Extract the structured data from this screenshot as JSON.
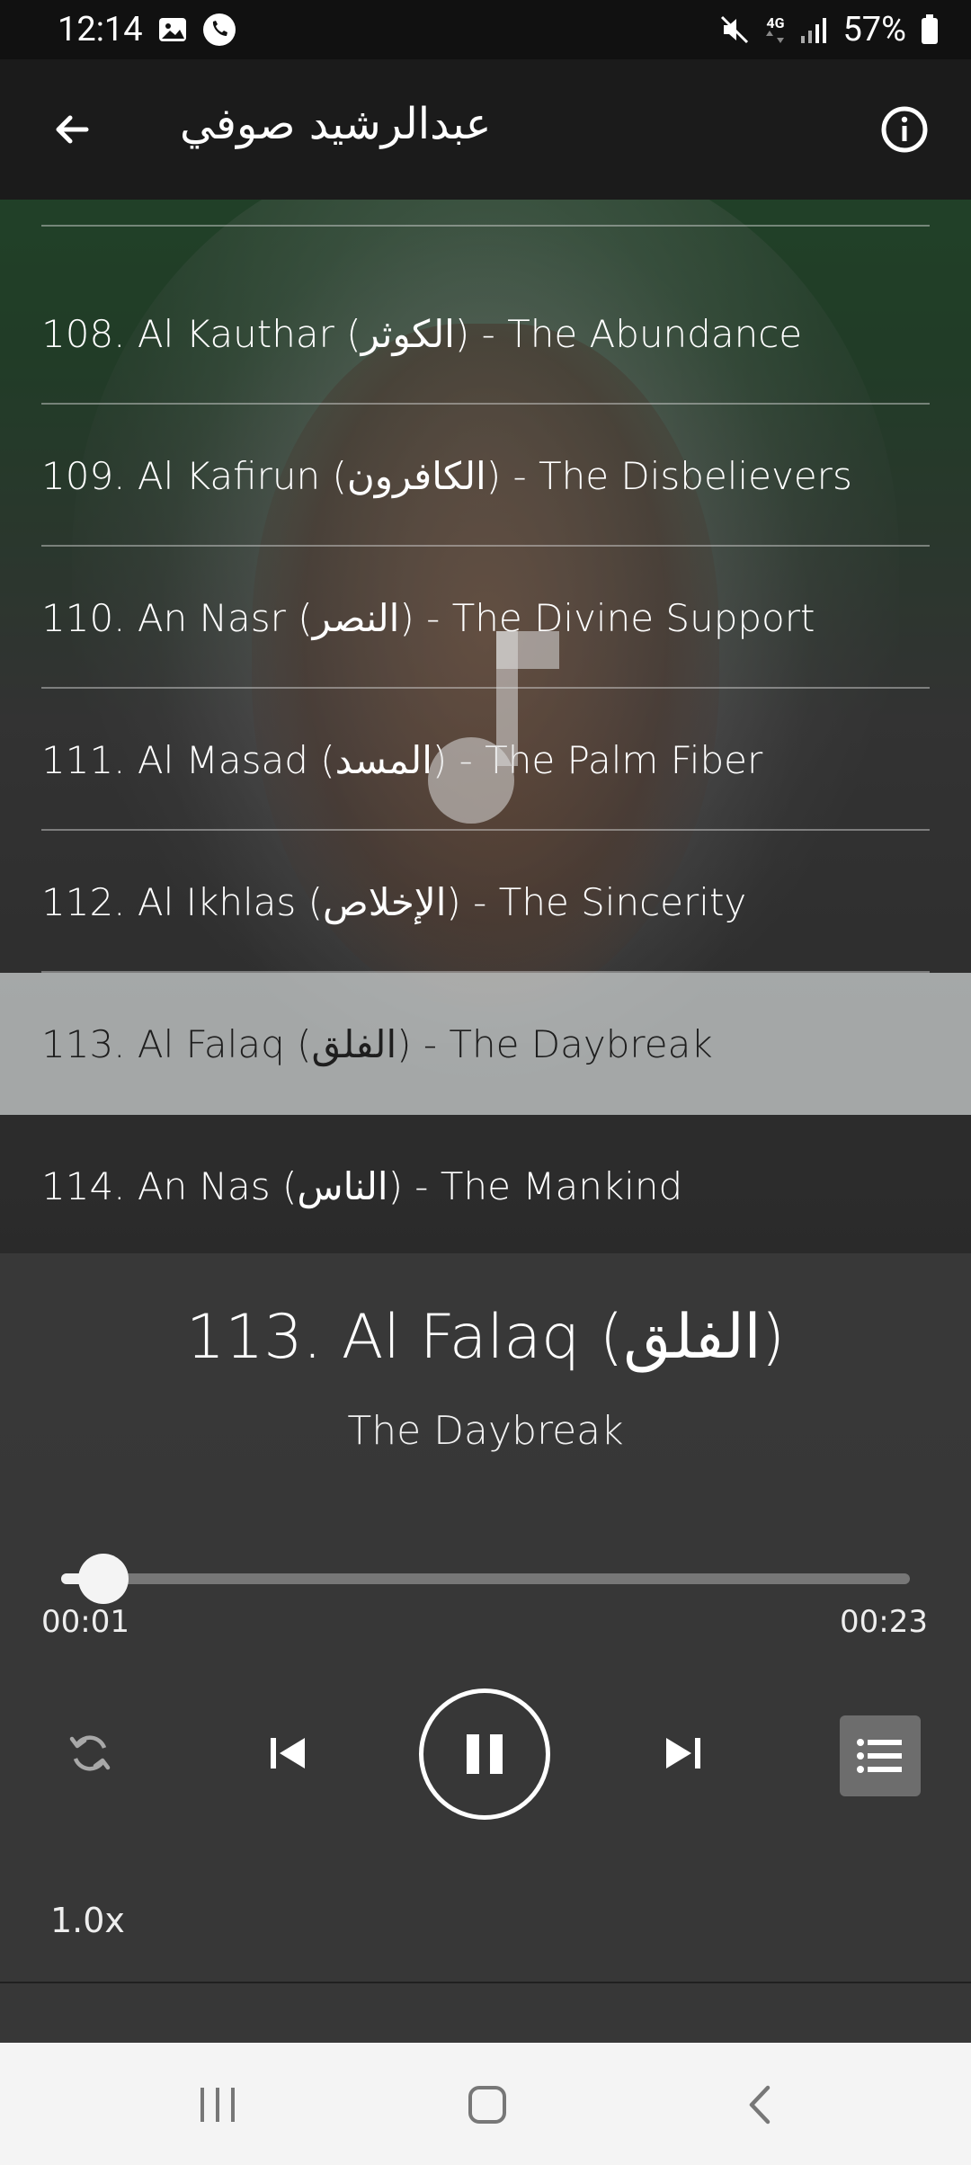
{
  "status_bar": {
    "time": "12:14",
    "network": "4G",
    "battery": "57%",
    "icons": [
      "gallery-icon",
      "phone-icon",
      "mute-icon",
      "network-4g-icon",
      "signal-icon",
      "battery-icon"
    ]
  },
  "app_bar": {
    "title": "عبدالرشيد صوفي",
    "back_icon": "arrow-left-icon",
    "info_icon": "info-icon"
  },
  "tracks": [
    {
      "label": "108. Al Kauthar (الكوثر) - The Abundance",
      "selected": false
    },
    {
      "label": "109. Al Kafirun (الكافرون) - The Disbelievers",
      "selected": false
    },
    {
      "label": "110. An Nasr (النصر) - The Divine Support",
      "selected": false
    },
    {
      "label": "111. Al Masad (المسد) - The Palm Fiber",
      "selected": false
    },
    {
      "label": "112. Al Ikhlas (الإخلاص) - The Sincerity",
      "selected": false
    },
    {
      "label": "113. Al Falaq (الفلق) - The Daybreak",
      "selected": true
    },
    {
      "label": "114. An Nas (الناس) - The Mankind",
      "selected": false
    }
  ],
  "player": {
    "now_title": "113. Al Falaq (الفلق)",
    "now_subtitle": "The Daybreak",
    "current_time": "00:01",
    "total_time": "00:23",
    "progress": 0.05,
    "speed": "1.0x",
    "controls": {
      "repeat_icon": "repeat-icon",
      "prev_icon": "skip-previous-icon",
      "play_icon": "pause-icon",
      "next_icon": "skip-next-icon",
      "playlist_icon": "playlist-icon"
    }
  },
  "nav_bar": {
    "icons": [
      "recent-apps-icon",
      "home-icon",
      "back-icon"
    ]
  },
  "colors": {
    "selected_row": "#d2d7d7",
    "app_bar": "#1b1b1b",
    "status_bar": "#111111",
    "nav_bar": "#f4f4f4"
  }
}
